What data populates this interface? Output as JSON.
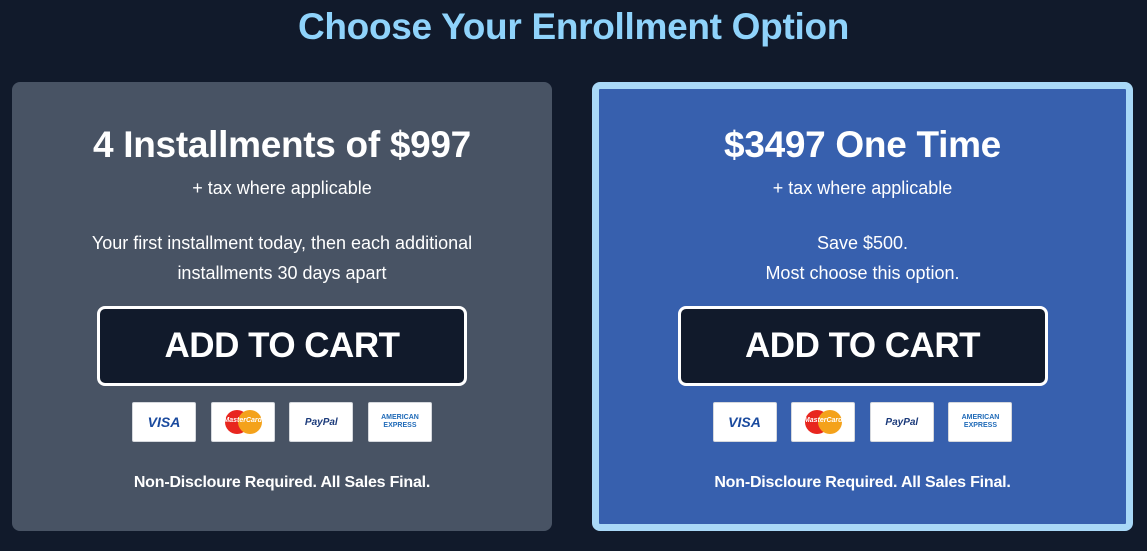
{
  "page": {
    "title": "Choose Your Enrollment Option"
  },
  "colors": {
    "background": "#111a2b",
    "title": "#8fd3fb",
    "left_card": "#485364",
    "right_card": "#3760ae",
    "right_card_border": "#a9d8f7",
    "button": "#111a2b"
  },
  "plans": [
    {
      "title": "4 Installments of $997",
      "tax_note": "+ tax where applicable",
      "description_line1": "Your first installment today, then each additional",
      "description_line2": "installments 30 days apart",
      "button_label": "ADD TO CART",
      "legal": "Non-Discloure Required. All Sales Final."
    },
    {
      "title": "$3497 One Time",
      "tax_note": "+ tax where applicable",
      "description_line1": "Save $500.",
      "description_line2": "Most choose this option.",
      "button_label": "ADD TO CART",
      "legal": "Non-Discloure Required. All Sales Final."
    }
  ],
  "payment_methods": {
    "visa": "VISA",
    "mastercard": "MasterCard",
    "paypal": "PayPal",
    "amex_line1": "AMERICAN",
    "amex_line2": "EXPRESS"
  },
  "icons": [
    "visa-icon",
    "mastercard-icon",
    "paypal-icon",
    "amex-icon"
  ]
}
